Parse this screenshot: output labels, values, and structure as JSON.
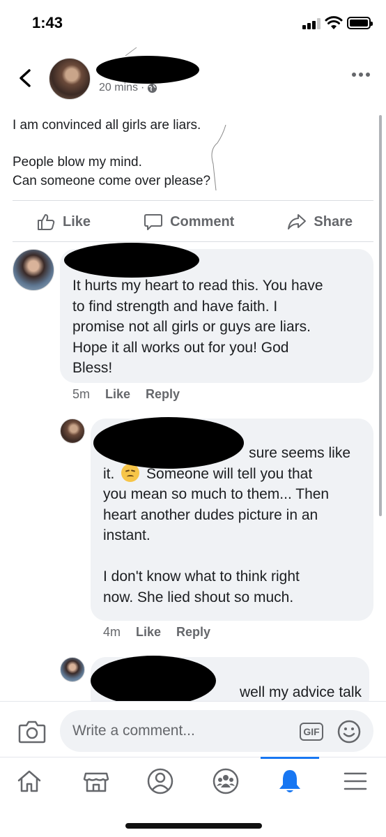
{
  "status_bar": {
    "time": "1:43"
  },
  "post": {
    "timestamp": "20 mins",
    "separator": "·",
    "lines": [
      "I am convinced all girls are liars.",
      "People blow my mind.",
      "Can someone come over please?"
    ]
  },
  "actions": {
    "like": "Like",
    "comment": "Comment",
    "share": "Share"
  },
  "comments": [
    {
      "text": "It hurts my heart to read this. You have to find strength and have faith. I promise not all girls or guys are liars. Hope it all works out for you! God Bless!",
      "lines": [
        "It hurts my heart to read this. You have",
        "to find strength and have faith. I",
        "promise not all girls or guys are liars.",
        "Hope it all works out for you! God",
        "Bless!"
      ],
      "time": "5m",
      "like": "Like",
      "reply": "Reply"
    },
    {
      "line1_visible": "sure seems like",
      "line2_a": "it.",
      "line2_b": "Someone will tell you that",
      "lines": [
        "you mean so much to them... Then",
        "heart another dudes picture in an",
        "instant."
      ],
      "lines2": [
        "I don't know what to think right",
        "now. She lied shout so much."
      ],
      "emoji": "disappointed-face",
      "time": "4m",
      "like": "Like",
      "reply": "Reply"
    },
    {
      "line1_visible": "well my advice talk"
    }
  ],
  "composer": {
    "placeholder": "Write a comment...",
    "gif": "GIF"
  },
  "colors": {
    "accent": "#1877f2",
    "bubble": "#f0f2f5",
    "muted": "#65676b"
  },
  "tabs": [
    {
      "icon": "home-icon"
    },
    {
      "icon": "marketplace-icon"
    },
    {
      "icon": "profile-icon"
    },
    {
      "icon": "groups-icon"
    },
    {
      "icon": "notifications-bell-icon",
      "active": true
    },
    {
      "icon": "menu-icon"
    }
  ]
}
